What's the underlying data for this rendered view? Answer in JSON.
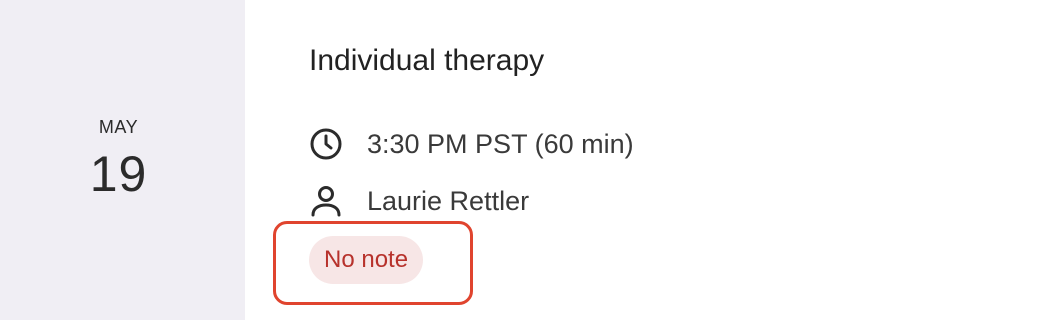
{
  "date": {
    "month": "MAY",
    "day": "19"
  },
  "appointment": {
    "title": "Individual therapy",
    "time": "3:30 PM PST (60 min)",
    "clinician": "Laurie Rettler",
    "note_status": "No note"
  },
  "icons": {
    "time": "clock-icon",
    "clinician": "person-icon"
  },
  "colors": {
    "date_background": "#f0eef4",
    "note_badge_background": "#f7e6e6",
    "note_badge_text": "#b7322c",
    "highlight_border": "#e0442e"
  }
}
